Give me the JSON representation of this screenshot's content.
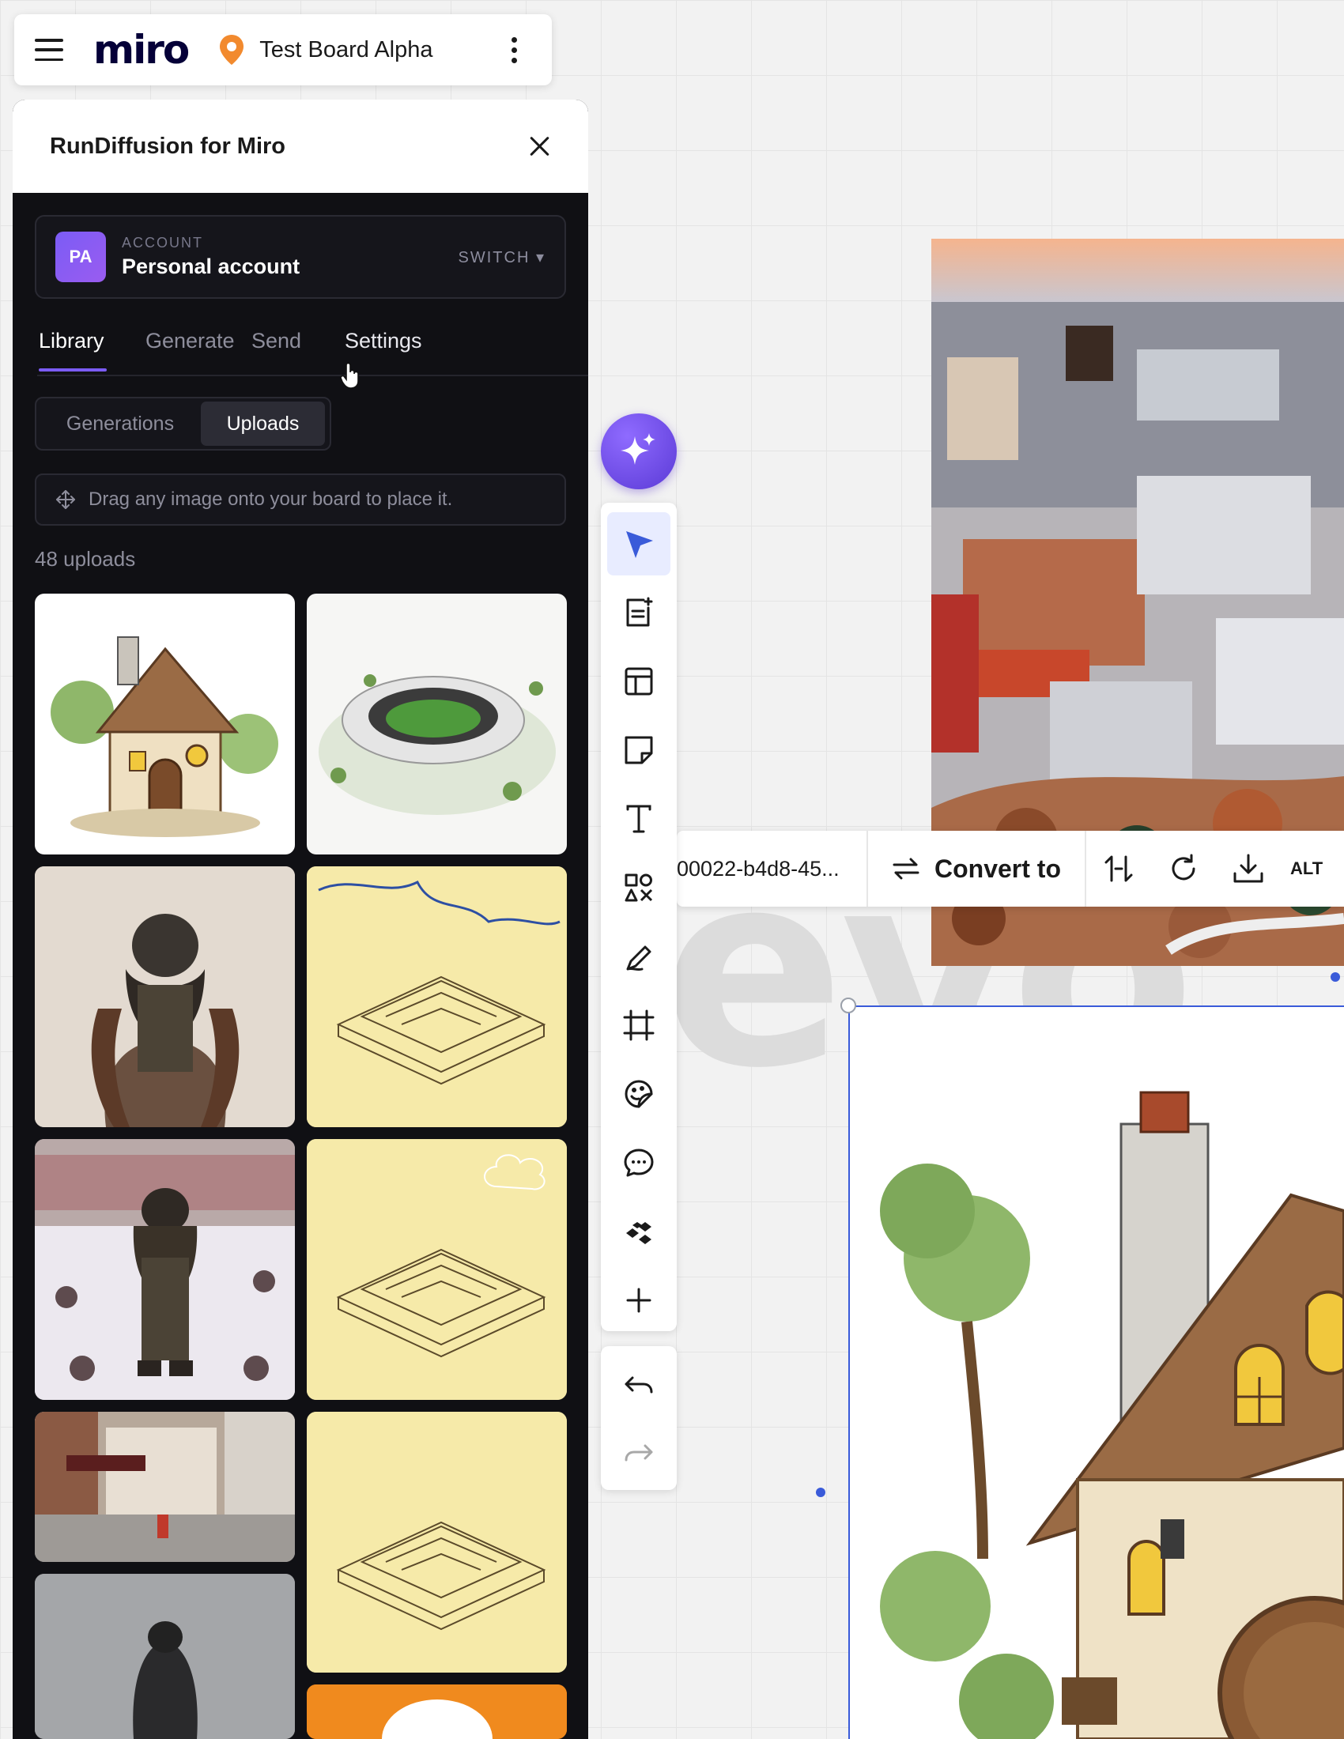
{
  "board": {
    "logo": "miro",
    "title": "Test Board Alpha"
  },
  "panel": {
    "title": "RunDiffusion for Miro",
    "account": {
      "initials": "PA",
      "label": "ACCOUNT",
      "name": "Personal account",
      "switch_label": "SWITCH ▾"
    },
    "tabs": [
      {
        "label": "Library",
        "active": true
      },
      {
        "label": "Generate",
        "active": false
      },
      {
        "label": "Send",
        "active": false
      },
      {
        "label": "Settings",
        "active": false
      }
    ],
    "segments": {
      "generations": "Generations",
      "uploads": "Uploads",
      "selected": "uploads"
    },
    "hint": "Drag any image onto your board to place it.",
    "count": "48 uploads"
  },
  "context_toolbar": {
    "file_name": "00022-b4d8-45...",
    "convert_label": "Convert to",
    "alt_label": "ALT"
  },
  "canvas": {
    "background_word": "evo"
  },
  "colors": {
    "accent": "#7b5cf5",
    "panel_bg": "#101014",
    "selection": "#3a5bd9"
  }
}
